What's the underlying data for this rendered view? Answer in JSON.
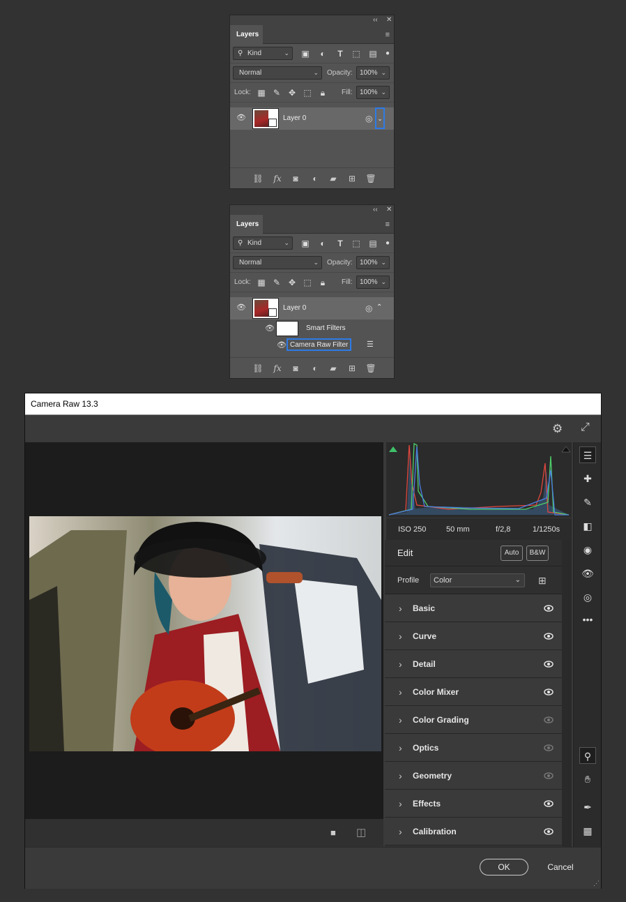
{
  "layers_panel": {
    "tab_label": "Layers",
    "filter_kind": "Kind",
    "blend_mode": "Normal",
    "opacity_label": "Opacity:",
    "opacity_value": "100%",
    "lock_label": "Lock:",
    "fill_label": "Fill:",
    "fill_value": "100%",
    "layer_name": "Layer 0"
  },
  "layers_panel_expanded": {
    "tab_label": "Layers",
    "filter_kind": "Kind",
    "blend_mode": "Normal",
    "opacity_label": "Opacity:",
    "opacity_value": "100%",
    "lock_label": "Lock:",
    "fill_label": "Fill:",
    "fill_value": "100%",
    "layer_name": "Layer 0",
    "smart_filters_label": "Smart Filters",
    "camera_raw_filter_label": "Camera Raw Filter"
  },
  "camera_raw": {
    "title": "Camera Raw 13.3",
    "exif": {
      "iso": "ISO 250",
      "focal": "50 mm",
      "aperture": "f/2,8",
      "shutter": "1/1250s"
    },
    "edit_title": "Edit",
    "auto_label": "Auto",
    "bw_label": "B&W",
    "profile_label": "Profile",
    "profile_value": "Color",
    "sections": [
      {
        "label": "Basic",
        "visible": true
      },
      {
        "label": "Curve",
        "visible": true
      },
      {
        "label": "Detail",
        "visible": true
      },
      {
        "label": "Color Mixer",
        "visible": true
      },
      {
        "label": "Color Grading",
        "visible": false
      },
      {
        "label": "Optics",
        "visible": false
      },
      {
        "label": "Geometry",
        "visible": false
      },
      {
        "label": "Effects",
        "visible": true
      },
      {
        "label": "Calibration",
        "visible": true
      }
    ],
    "ok_label": "OK",
    "cancel_label": "Cancel"
  }
}
